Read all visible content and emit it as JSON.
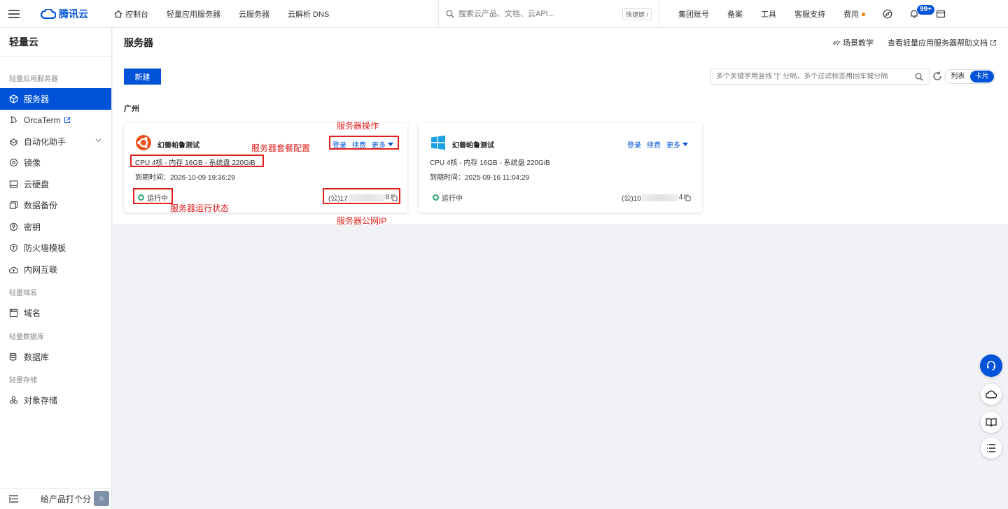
{
  "topnav": {
    "brand": "腾讯云",
    "links": [
      "控制台",
      "轻量应用服务器",
      "云服务器",
      "云解析 DNS"
    ],
    "search_placeholder": "搜索云产品、文档、云API...",
    "shortcut": "快捷键 /",
    "right_links": [
      "集团账号",
      "备案",
      "工具",
      "客服支持",
      "费用"
    ],
    "notification_badge": "99+"
  },
  "sidebar": {
    "title": "轻量云",
    "sections": [
      {
        "label": "轻量应用服务器",
        "items": [
          {
            "label": "服务器",
            "icon": "cube-icon",
            "active": true
          },
          {
            "label": "OrcaTerm",
            "icon": "orca-icon",
            "external": true
          },
          {
            "label": "自动化助手",
            "icon": "assistant-icon",
            "expandable": true
          },
          {
            "label": "镜像",
            "icon": "disc-icon"
          },
          {
            "label": "云硬盘",
            "icon": "disk-icon"
          },
          {
            "label": "数据备份",
            "icon": "backup-icon"
          },
          {
            "label": "密钥",
            "icon": "key-icon"
          },
          {
            "label": "防火墙模板",
            "icon": "shield-icon"
          },
          {
            "label": "内网互联",
            "icon": "network-icon"
          }
        ]
      },
      {
        "label": "轻量域名",
        "items": [
          {
            "label": "域名",
            "icon": "domain-icon"
          }
        ]
      },
      {
        "label": "轻量数据库",
        "items": [
          {
            "label": "数据库",
            "icon": "database-icon"
          }
        ]
      },
      {
        "label": "轻量存储",
        "items": [
          {
            "label": "对象存储",
            "icon": "storage-icon"
          }
        ]
      }
    ],
    "rate_label": "给产品打个分"
  },
  "main": {
    "title": "服务器",
    "header_links": [
      "场景教学",
      "查看轻量应用服务器帮助文档"
    ],
    "new_button": "新建",
    "filter_placeholder": "多个关键字用竖线 \"|\" 分隔，多个过滤标签用回车键分隔",
    "view_list": "列表",
    "view_card": "卡片",
    "region": "广州"
  },
  "cards": [
    {
      "name": "幻兽帕鲁测试",
      "os_icon": "ubuntu-icon",
      "actions": [
        "登录",
        "续费",
        "更多"
      ],
      "spec": "CPU 4核 - 内存 16GB - 系统盘 220GiB",
      "expire": "到期时间：2026-10-09 19:36:29",
      "status": "运行中",
      "ip_prefix": "(公)17",
      "ip_suffix": "8"
    },
    {
      "name": "幻兽帕鲁测试",
      "os_icon": "windows-icon",
      "actions": [
        "登录",
        "续费",
        "更多"
      ],
      "spec": "CPU 4核 - 内存 16GB - 系统盘 220GiB",
      "expire": "到期时间：2025-09-16 11:04:29",
      "status": "运行中",
      "ip_prefix": "(公)10",
      "ip_suffix": "4"
    }
  ],
  "annotations": {
    "ops": "服务器操作",
    "spec": "服务器套餐配置",
    "status": "服务器运行状态",
    "ip": "服务器公网IP"
  },
  "colors": {
    "accent": "#0052d9",
    "running": "#2ba471",
    "annotation": "#e0211d"
  }
}
